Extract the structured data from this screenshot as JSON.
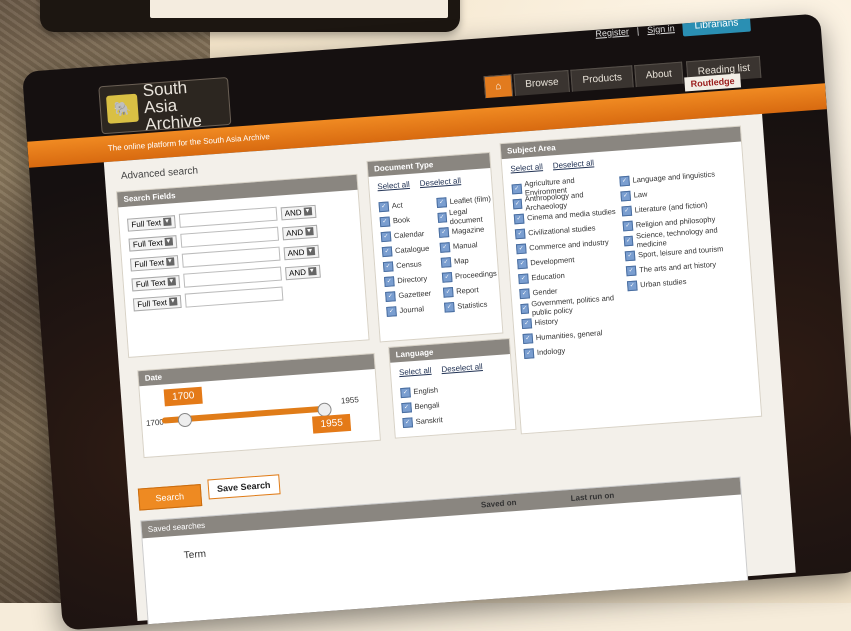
{
  "header": {
    "register": "Register",
    "separator": "|",
    "signin": "Sign in",
    "librarians": "Librarians"
  },
  "logo": {
    "line1": "South Asia",
    "line2": "Archive"
  },
  "nav": {
    "browse": "Browse",
    "products": "Products",
    "about": "About",
    "reading_list": "Reading list"
  },
  "tagline": "The online platform for the South Asia Archive",
  "brand": "Routledge",
  "page": {
    "title": "Advanced search"
  },
  "search_fields": {
    "title": "Search Fields",
    "rows": [
      {
        "field": "Full Text",
        "op": "AND"
      },
      {
        "field": "Full Text",
        "op": "AND"
      },
      {
        "field": "Full Text",
        "op": "AND"
      },
      {
        "field": "Full Text",
        "op": "AND"
      },
      {
        "field": "Full Text",
        "op": ""
      }
    ]
  },
  "document_type": {
    "title": "Document Type",
    "select_all": "Select all",
    "deselect_all": "Deselect all",
    "col1": [
      "Act",
      "Book",
      "Calendar",
      "Catalogue",
      "Census",
      "Directory",
      "Gazetteer",
      "Journal"
    ],
    "col2": [
      "Leaflet (film)",
      "Legal document",
      "Magazine",
      "Manual",
      "Map",
      "Proceedings",
      "Report",
      "Statistics"
    ]
  },
  "subject_area": {
    "title": "Subject Area",
    "select_all": "Select all",
    "deselect_all": "Deselect all",
    "col1": [
      "Agriculture and Environment",
      "Anthropology and Archaeology",
      "Cinema and media studies",
      "Civilizational studies",
      "Commerce and industry",
      "Development",
      "Education",
      "Gender",
      "Government, politics and public policy",
      "History",
      "Humanities, general",
      "Indology"
    ],
    "col2": [
      "Language and linguistics",
      "Law",
      "Literature (and fiction)",
      "Religion and philosophy",
      "Science, technology and medicine",
      "Sport, leisure and tourism",
      "The arts and art history",
      "Urban studies"
    ]
  },
  "date": {
    "title": "Date",
    "min": "1700",
    "max": "1955",
    "from": "1700",
    "to": "1955"
  },
  "language": {
    "title": "Language",
    "select_all": "Select all",
    "deselect_all": "Deselect all",
    "items": [
      "English",
      "Bengali",
      "Sanskrit"
    ]
  },
  "buttons": {
    "search": "Search",
    "save_search": "Save Search"
  },
  "saved_searches": {
    "title": "Saved searches",
    "col_term": "Term",
    "col_saved_on": "Saved on",
    "col_last_run": "Last run on"
  }
}
